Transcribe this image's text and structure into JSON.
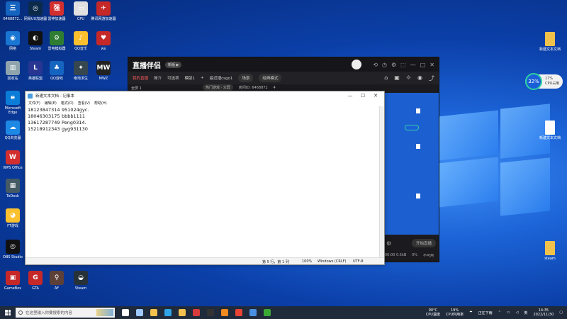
{
  "desktop": {
    "icons_left": [
      {
        "label": "6468872...",
        "color": "#1565c0",
        "glyph": "三"
      },
      {
        "label": "网易UU加速器",
        "color": "#0b2a4a",
        "glyph": "◎"
      },
      {
        "label": "雷神加速器",
        "color": "#d32f2f",
        "glyph": "强"
      },
      {
        "label": "CPU",
        "color": "#e0e0e0",
        "glyph": "▭"
      },
      {
        "label": "腾讯网游加速器",
        "color": "#c62828",
        "glyph": "✈"
      },
      {
        "label": "网络",
        "color": "#1976d2",
        "glyph": "◉"
      },
      {
        "label": "Steam",
        "color": "#111",
        "glyph": "◐"
      },
      {
        "label": "雷电模拟器",
        "color": "#2e7d32",
        "glyph": "⚙"
      },
      {
        "label": "QQ音乐",
        "color": "#fbc02d",
        "glyph": "♪"
      },
      {
        "label": "wx",
        "color": "#c62828",
        "glyph": "♥"
      },
      {
        "label": "回收站",
        "color": "#90a4ae",
        "glyph": "▥"
      },
      {
        "label": "英雄联盟",
        "color": "#283593",
        "glyph": "L"
      },
      {
        "label": "QQ游戏",
        "color": "#1565c0",
        "glyph": "♣"
      },
      {
        "label": "绝地求生",
        "color": "#37474f",
        "glyph": "✦"
      },
      {
        "label": "MWZ",
        "color": "#222",
        "glyph": "MW"
      },
      {
        "label": "Microsoft Edge",
        "color": "#0b7dd8",
        "glyph": "e"
      },
      {
        "label": "QQ浏览器",
        "color": "#1e88e5",
        "glyph": "☁"
      },
      {
        "label": "WPS Office",
        "color": "#d32f2f",
        "glyph": "W"
      },
      {
        "label": "ToDesk",
        "color": "#455a64",
        "glyph": "▦"
      },
      {
        "label": "FT游戏",
        "color": "#fbc02d",
        "glyph": "◕"
      },
      {
        "label": "OBS Studio",
        "color": "#111",
        "glyph": "◎"
      },
      {
        "label": "GameBox",
        "color": "#c62828",
        "glyph": "▣"
      },
      {
        "label": "GTA",
        "color": "#c62828",
        "glyph": "G"
      },
      {
        "label": "AF",
        "color": "#5d4037",
        "glyph": "♀"
      },
      {
        "label": "Steam",
        "color": "#263238",
        "glyph": "◒"
      }
    ],
    "icons_right": [
      {
        "label": "新建文本文档",
        "color": "#f0c24b",
        "glyph": ""
      },
      {
        "label": "新建文本文档",
        "color": "#ffffff",
        "glyph": ""
      },
      {
        "label": "steam",
        "color": "#f0c24b",
        "glyph": ""
      }
    ]
  },
  "live": {
    "app_name": "直播伴侣",
    "version": "新版 ▶",
    "tabs": [
      "我的直播",
      "简介",
      "可选项",
      "模版1"
    ],
    "add": "+",
    "room_label": "最近播csgo1",
    "mode_pill": "场景",
    "classic": "经典模式",
    "row2": [
      "热门游戏 · 大屏",
      "房间ID: 6468872",
      "4"
    ],
    "tool_icons": [
      "⟲",
      "◷",
      "⚙",
      "⬚",
      "—",
      "□",
      "✕"
    ],
    "right_icons": [
      "⌂",
      "▣",
      "☼",
      "◉",
      "⤴"
    ],
    "bottom_button": "开始直播",
    "bottom_labels": [
      "00:00",
      "0.5kB",
      "0%",
      "不可用"
    ],
    "preview_label": "全屏 1"
  },
  "notepad": {
    "title": "新建文本文档 - 记事本",
    "menu": [
      "文件(F)",
      "编辑(E)",
      "格式(O)",
      "查看(V)",
      "帮助(H)"
    ],
    "lines": [
      {
        "num": "18123847314",
        "val": "951024gyc."
      },
      {
        "num": "18046303175",
        "val": "bbbb1111"
      },
      {
        "num": "13617287749",
        "val": "Peng0314."
      },
      {
        "num": "15218912343",
        "val": "gyg931130"
      }
    ],
    "status": {
      "pos": "第 5 行，第 1 列",
      "zoom": "100%",
      "eol": "Windows (CRLF)",
      "enc": "UTF-8"
    },
    "min": "—",
    "max": "☐",
    "close": "✕"
  },
  "gauge": {
    "percent": "32%",
    "line1": "17%",
    "line2": "CPU占用"
  },
  "taskbar": {
    "search_placeholder": "在这里输入你要搜索的内容",
    "icons": [
      {
        "name": "cortana",
        "color": "#ffffff"
      },
      {
        "name": "task-view",
        "color": "#9ec9ff"
      },
      {
        "name": "files",
        "color": "#f2c14e"
      },
      {
        "name": "edge",
        "color": "#2fa4e7"
      },
      {
        "name": "explorer",
        "color": "#f2c14e"
      },
      {
        "name": "app-red",
        "color": "#d83b3b"
      },
      {
        "name": "obs",
        "color": "#333333"
      },
      {
        "name": "app-orange",
        "color": "#f18a1f"
      },
      {
        "name": "app-red2",
        "color": "#e94335"
      },
      {
        "name": "app-blue",
        "color": "#4a90e2"
      },
      {
        "name": "app-green",
        "color": "#3aaa35"
      }
    ],
    "cpu_temp": "90°C",
    "cpu_temp_label": "CPU温度",
    "cpu_use": "19%",
    "cpu_use_label": "CPU利用率",
    "weather": "正在下雨",
    "time": "14:35",
    "date": "2022/11/30"
  }
}
